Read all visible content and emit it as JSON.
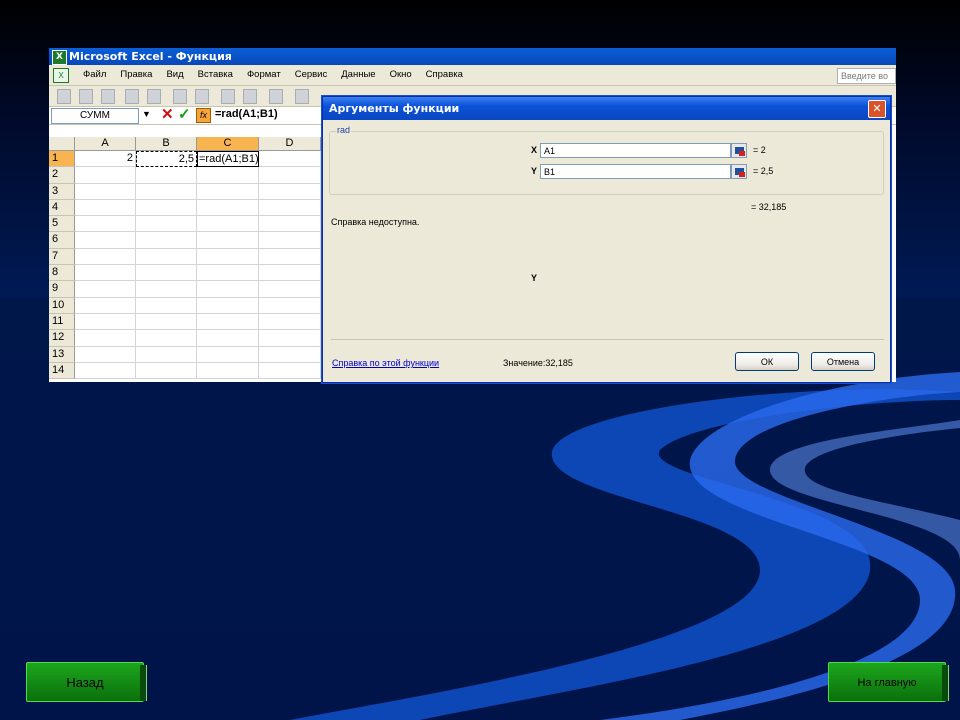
{
  "window": {
    "title": "Microsoft Excel - Функция"
  },
  "menu": {
    "items": [
      "Файл",
      "Правка",
      "Вид",
      "Вставка",
      "Формат",
      "Сервис",
      "Данные",
      "Окно",
      "Справка"
    ],
    "help_search": "Введите во"
  },
  "formula_bar": {
    "name_box": "СУММ",
    "formula": "=rad(A1;B1)"
  },
  "sheet": {
    "columns": [
      "A",
      "B",
      "C",
      "D"
    ],
    "rows": [
      "1",
      "2",
      "3",
      "4",
      "5",
      "6",
      "7",
      "8",
      "9",
      "10",
      "11",
      "12",
      "13",
      "14"
    ],
    "cells": {
      "A1": "2",
      "B1": "2,5",
      "C1": "=rad(A1;B1)"
    }
  },
  "dialog": {
    "title": "Аргументы функции",
    "group_label": "rad",
    "args": [
      {
        "label": "X",
        "value": "A1",
        "result": "= 2"
      },
      {
        "label": "Y",
        "value": "B1",
        "result": "= 2,5"
      }
    ],
    "result": "= 32,185",
    "description": "Справка недоступна.",
    "arg_description": "Y",
    "help_link": "Справка по этой функции",
    "value_line": "Значение:32,185",
    "ok": "ОК",
    "cancel": "Отмена"
  },
  "nav": {
    "back": "Назад",
    "home": "На главную"
  },
  "colors": {
    "accent": "#0a47c2",
    "nav_green": "#1da61d",
    "active_header": "#f9b452"
  }
}
